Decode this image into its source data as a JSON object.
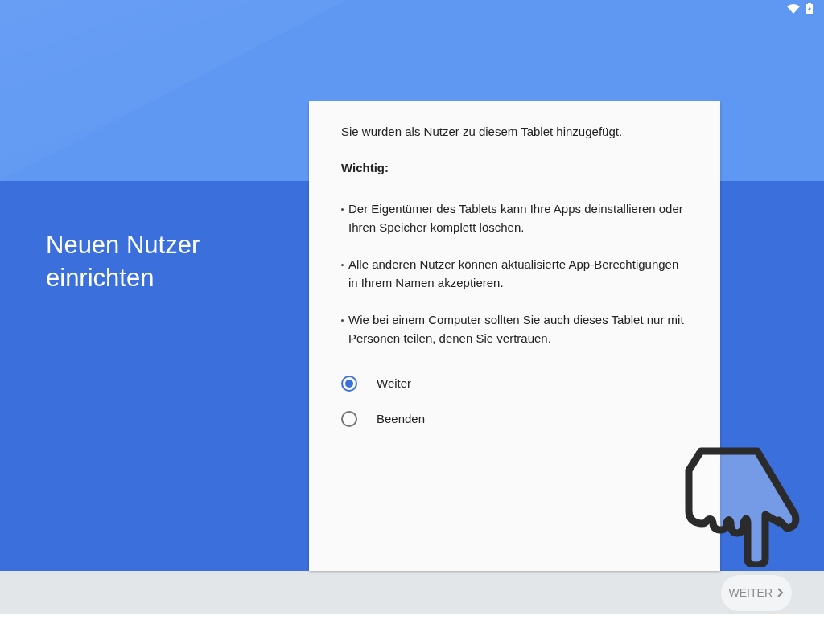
{
  "heading": "Neuen Nutzer einrichten",
  "intro": "Sie wurden als Nutzer zu diesem Tablet hinzugefügt.",
  "important_label": "Wichtig:",
  "bullets": [
    "Der Eigentümer des Tablets kann Ihre Apps deinstallieren oder Ihren Speicher komplett löschen.",
    "Alle anderen Nutzer können aktualisierte App-Berechtigungen in Ihrem Namen akzeptieren.",
    "Wie bei einem Computer sollten Sie auch dieses Tablet nur mit Personen teilen, denen Sie vertrauen."
  ],
  "options": [
    {
      "label": "Weiter",
      "selected": true
    },
    {
      "label": "Beenden",
      "selected": false
    }
  ],
  "next_button": {
    "label": "WEITER"
  }
}
